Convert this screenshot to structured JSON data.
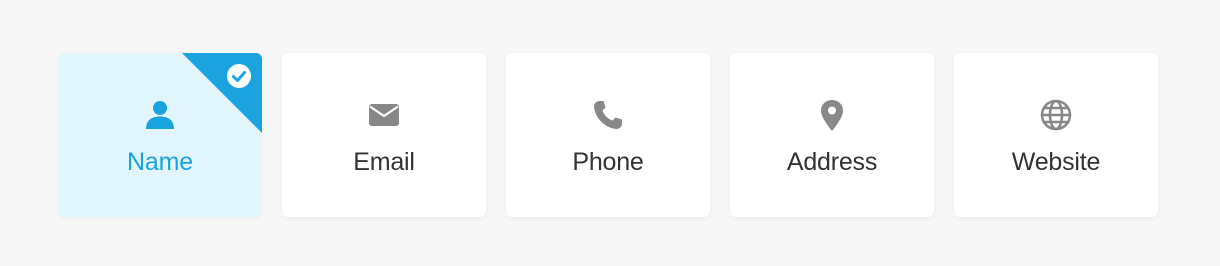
{
  "colors": {
    "accent": "#1aa3df",
    "selected_bg": "#e1f5fd",
    "icon_gray": "#888888",
    "label_dark": "#333333"
  },
  "cards": [
    {
      "label": "Name",
      "icon": "user-icon",
      "selected": true
    },
    {
      "label": "Email",
      "icon": "envelope-icon",
      "selected": false
    },
    {
      "label": "Phone",
      "icon": "phone-icon",
      "selected": false
    },
    {
      "label": "Address",
      "icon": "map-pin-icon",
      "selected": false
    },
    {
      "label": "Website",
      "icon": "globe-icon",
      "selected": false
    }
  ]
}
